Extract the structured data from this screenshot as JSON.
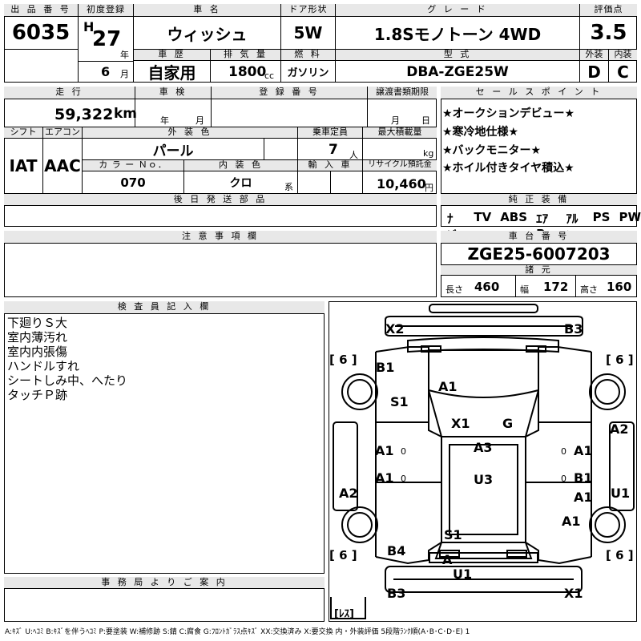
{
  "header": {
    "lot_label": "出 品 番 号",
    "lot_value": "6035",
    "first_reg_label": "初度登録",
    "era": "H",
    "year": "27",
    "year_unit": "年",
    "month": "6",
    "month_unit": "月",
    "name_label": "車 名",
    "name_value": "ウィッシュ",
    "history_label": "車 歴",
    "history_value": "自家用",
    "displacement_label": "排 気 量",
    "displacement_value": "1800",
    "displacement_unit": "cc",
    "door_label": "ドア形状",
    "door_value": "5W",
    "fuel_label": "燃 料",
    "fuel_value": "ガソリン",
    "grade_label": "グ レ ー ド",
    "grade_value": "1.8Sモノトーン 4WD",
    "model_label": "型 式",
    "model_value": "DBA-ZGE25W",
    "score_label": "評価点",
    "score_value": "3.5",
    "exterior_label": "外装",
    "exterior_value": "D",
    "interior_label": "内装",
    "interior_value": "C"
  },
  "row2": {
    "mileage_label": "走 行",
    "mileage_value": "59,322",
    "mileage_unit": "km",
    "inspection_label": "車 検",
    "inspection_year": "年",
    "inspection_month": "月",
    "regno_label": "登 録 番 号",
    "transfer_label": "譲渡書類期限",
    "transfer_month": "月",
    "transfer_day": "日",
    "shift_label": "シフト",
    "shift_value": "IAT",
    "ac_label": "エアコン",
    "ac_value": "AAC",
    "color_label": "外 装 色",
    "color_value": "パール",
    "capacity_label": "乗車定員",
    "capacity_value": "7",
    "capacity_unit": "人",
    "load_label": "最大積載量",
    "load_unit": "kg",
    "colorno_label": "カ ラ ー Ｎｏ．",
    "colorno_value": "070",
    "intcolor_label": "内 装 色",
    "intcolor_value": "クロ",
    "intcolor_unit": "系",
    "import_label": "輸 入 車",
    "recycle_label": "リサイクル預託金",
    "recycle_value": "10,460",
    "recycle_unit": "円",
    "later_label": "後 日 発 送 部 品"
  },
  "sales": {
    "label": "セ ー ル ス ポ イ ン ト",
    "points": [
      "★オークションデビュー★",
      "★寒冷地仕様★",
      "★バックモニター★",
      "★ホイル付きタイヤ積込★"
    ]
  },
  "equipment": {
    "label": "純 正 装 備",
    "items": [
      "ﾅﾋﾞ",
      "TV",
      "ABS",
      "ｴｱB",
      "ｱﾙﾐ",
      "PS",
      "PW"
    ]
  },
  "caution": {
    "label": "注 意 事 項 欄"
  },
  "chassis": {
    "label": "車 台 番 号",
    "value": "ZGE25-6007203",
    "spec_label": "諸 元",
    "length_label": "長さ",
    "length_value": "460",
    "width_label": "幅",
    "width_value": "172",
    "height_label": "高さ",
    "height_value": "160"
  },
  "inspector": {
    "label": "検 査 員 記 入 欄",
    "notes": [
      "下廻りＳ大",
      "室内薄汚れ",
      "室内内張傷",
      "ハンドルすれ",
      "シートしみ中、へたり",
      "タッチＰ跡"
    ]
  },
  "office": {
    "label": "事 務 局 よ り ご 案 内"
  },
  "diagram": {
    "tires": [
      "[ 6 ]",
      "[ 6 ]",
      "[ 6 ]",
      "[ 6 ]"
    ],
    "spare": "[ﾚｽ]",
    "marks": [
      "X2",
      "B3",
      "B1",
      "S1",
      "A1",
      "X1",
      "G",
      "A2",
      "A1",
      "A1",
      "A3",
      "A1",
      "A1",
      "U3",
      "B1",
      "A2",
      "A1",
      "U1",
      "A1",
      "S1",
      "B4",
      "A",
      "U1",
      "B3",
      "X1"
    ],
    "zeros": [
      "0",
      "0",
      "0",
      "0"
    ]
  },
  "legend": "A:ｷｽﾞ U:ﾍｺﾐ B:ｷｽﾞを伴うﾍｺﾐ P:要塗装 W:補修跡 S:錆 C:腐食 G:ﾌﾛﾝﾄｶﾞﾗｽ点ｷｽﾞ XX:交換済み X:要交換 内・外装評価 5段階ﾗﾝｸ順(A･B･C･D･E) 1"
}
